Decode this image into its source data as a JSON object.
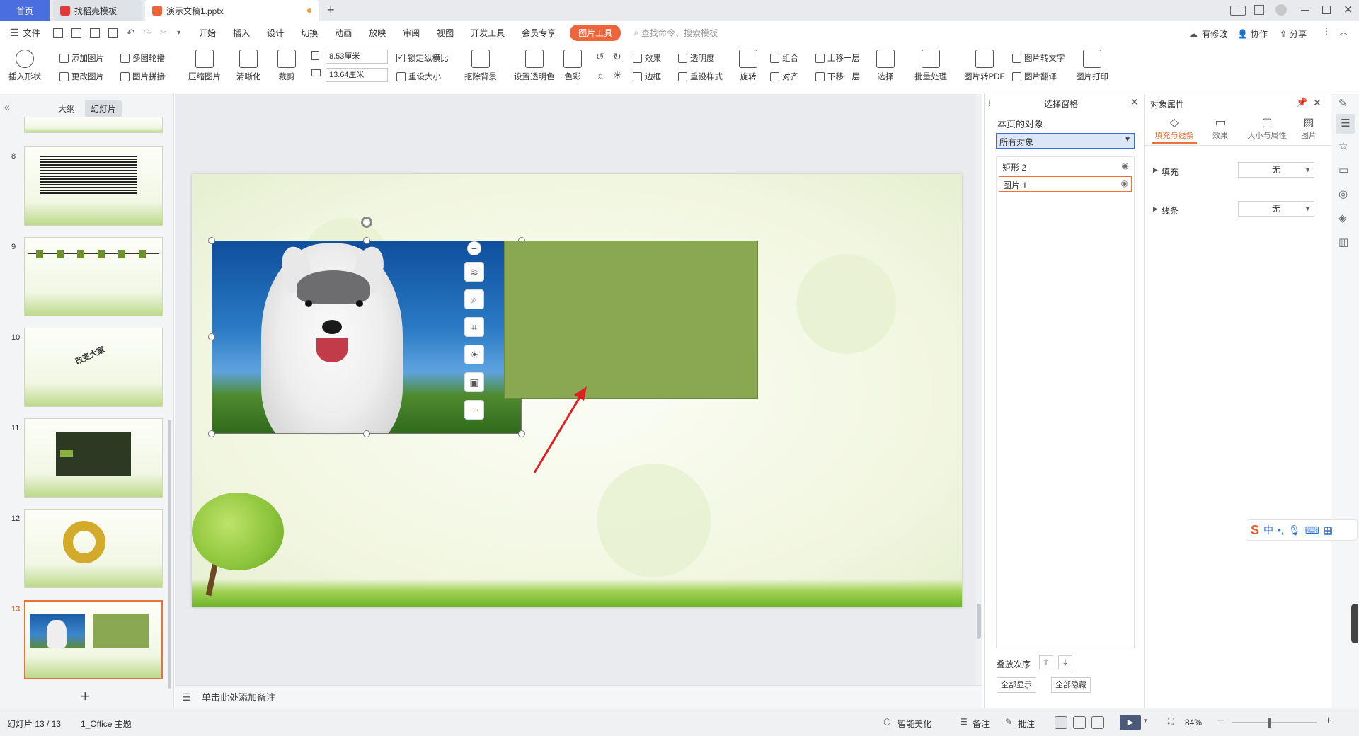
{
  "tabs": {
    "home": "首页",
    "template": "找稻壳模板",
    "doc": "演示文稿1.pptx",
    "add": "+"
  },
  "menu": {
    "file": "文件",
    "items": [
      "开始",
      "插入",
      "设计",
      "切换",
      "动画",
      "放映",
      "审阅",
      "视图",
      "开发工具",
      "会员专享"
    ],
    "picture_tools": "图片工具",
    "search": "查找命令、搜索模板",
    "has_changes": "有修改",
    "collab": "协作",
    "share": "分享"
  },
  "ribbon": {
    "insert_shape": "插入形状",
    "add_picture": "添加图片",
    "change_picture": "更改图片",
    "multi_carousel": "多图轮播",
    "picture_stitch": "图片拼接",
    "compress": "压缩图片",
    "sharpen": "清晰化",
    "crop": "裁剪",
    "height": "8.53厘米",
    "width": "13.64厘米",
    "lock_ratio": "锁定纵横比",
    "reset_size": "重设大小",
    "remove_bg": "抠除背景",
    "set_transparent": "设置透明色",
    "color": "色彩",
    "effects": "效果",
    "transparency": "透明度",
    "border": "边框",
    "reset_style": "重设样式",
    "rotate": "旋转",
    "group": "组合",
    "align": "对齐",
    "bring_forward": "上移一层",
    "send_backward": "下移一层",
    "select": "选择",
    "batch": "批量处理",
    "to_pdf": "图片转PDF",
    "to_text": "图片转文字",
    "translate": "图片翻译",
    "print": "图片打印"
  },
  "leftpane": {
    "outline_tab": "大纲",
    "slides_tab": "幻灯片",
    "slide_numbers": [
      "8",
      "9",
      "10",
      "11",
      "12",
      "13"
    ],
    "slide10_text": "改变大家",
    "add_slide": "+"
  },
  "notes": {
    "placeholder": "单击此处添加备注"
  },
  "selection_pane": {
    "title": "选择窗格",
    "objects_label": "本页的对象",
    "filter": "所有对象",
    "items": [
      "矩形 2",
      "图片 1"
    ],
    "order_label": "叠放次序",
    "show_all": "全部显示",
    "hide_all": "全部隐藏"
  },
  "property_pane": {
    "title": "对象属性",
    "tabs": [
      "填充与线条",
      "效果",
      "大小与属性",
      "图片"
    ],
    "fill_label": "填充",
    "fill_value": "无",
    "line_label": "线条",
    "line_value": "无"
  },
  "status": {
    "slide_info": "幻灯片 13 / 13",
    "theme": "1_Office 主题",
    "beautify": "智能美化",
    "notes": "备注",
    "comments": "批注",
    "zoom": "84%"
  },
  "colors": {
    "accent": "#f0643c",
    "home_tab": "#4a6ee0",
    "rect_fill": "#8aa752"
  }
}
